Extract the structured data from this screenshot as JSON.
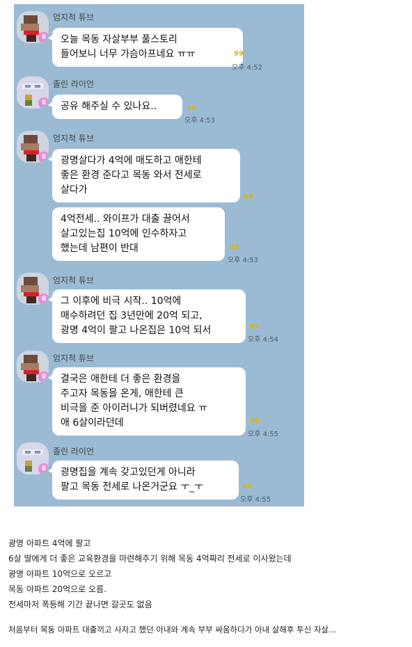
{
  "chat": {
    "messages": [
      {
        "sender": "엄지척 튜브",
        "avatar": "brown-profile",
        "bubbles": [
          {
            "text": "오늘 목동 자살부부 풀스토리\n들어보니 너무 가슴아프네요 ㅠㅠ",
            "unread": "99",
            "time": "오후 4:52"
          }
        ]
      },
      {
        "sender": "졸린 라이언",
        "avatar": "lion-profile",
        "bubbles": [
          {
            "text": "공유 해주실 수 있나요..",
            "unread": "99",
            "time": "오후 4:53"
          }
        ]
      },
      {
        "sender": "엄지척 튜브",
        "avatar": "brown-profile",
        "bubbles": [
          {
            "text": "광명살다가 4억에 매도하고 애한테\n좋은 환경 준다고 목동 와서 전세로\n살다가",
            "unread": "99",
            "time": ""
          },
          {
            "text": "4억전세.. 와이프가 대출 끌어서\n살고있는집 10억에 인수하자고\n했는데 남편이 반대",
            "unread": "99",
            "time": "오후 4:53"
          }
        ]
      },
      {
        "sender": "엄지척 튜브",
        "avatar": "brown-profile",
        "bubbles": [
          {
            "text": "그 이후에 비극 시작.. 10억에\n매수하려던 집 3년만에 20억 되고,\n광명 4억이 팔고 나온집은 10억 되서",
            "unread": "99",
            "time": "오후 4:54"
          }
        ]
      },
      {
        "sender": "엄지척 튜브",
        "avatar": "brown-profile",
        "bubbles": [
          {
            "text": "결국은 애한테 더 좋은 환경을\n주고자 목동을 온게, 애한테 큰\n비극을 준 아이러니가 되버렸네요 ㅠ\n애 6살이라던데",
            "unread": "99",
            "time": "오후 4:55"
          }
        ]
      },
      {
        "sender": "졸린 라이언",
        "avatar": "lion-profile",
        "bubbles": [
          {
            "text": "광명집을 계속 갖고있던게 아니라\n팔고 목동 전세로 나온거군요 ㅜ_ㅜ",
            "unread": "99",
            "time": "오후 4:55"
          }
        ]
      }
    ]
  },
  "caption": {
    "lines": [
      "광명 아파트 4억에 팔고",
      "6살 딸에게 더 좋은 교육환경을 마련해주기 위해 목동 4억짜리 전세로 이사왔는데",
      "광명 아파트 10억으로 오르고",
      "목동 아파트 20억으로 오름.",
      "전세마저 폭등해 기간 끝나면 갈곳도 없음"
    ],
    "final_line": "처음부터 목동 아파트 대출끼고 사자고 했던 아내와 계속 부부 싸움하다가 아내 살해후 투신 자살..."
  }
}
